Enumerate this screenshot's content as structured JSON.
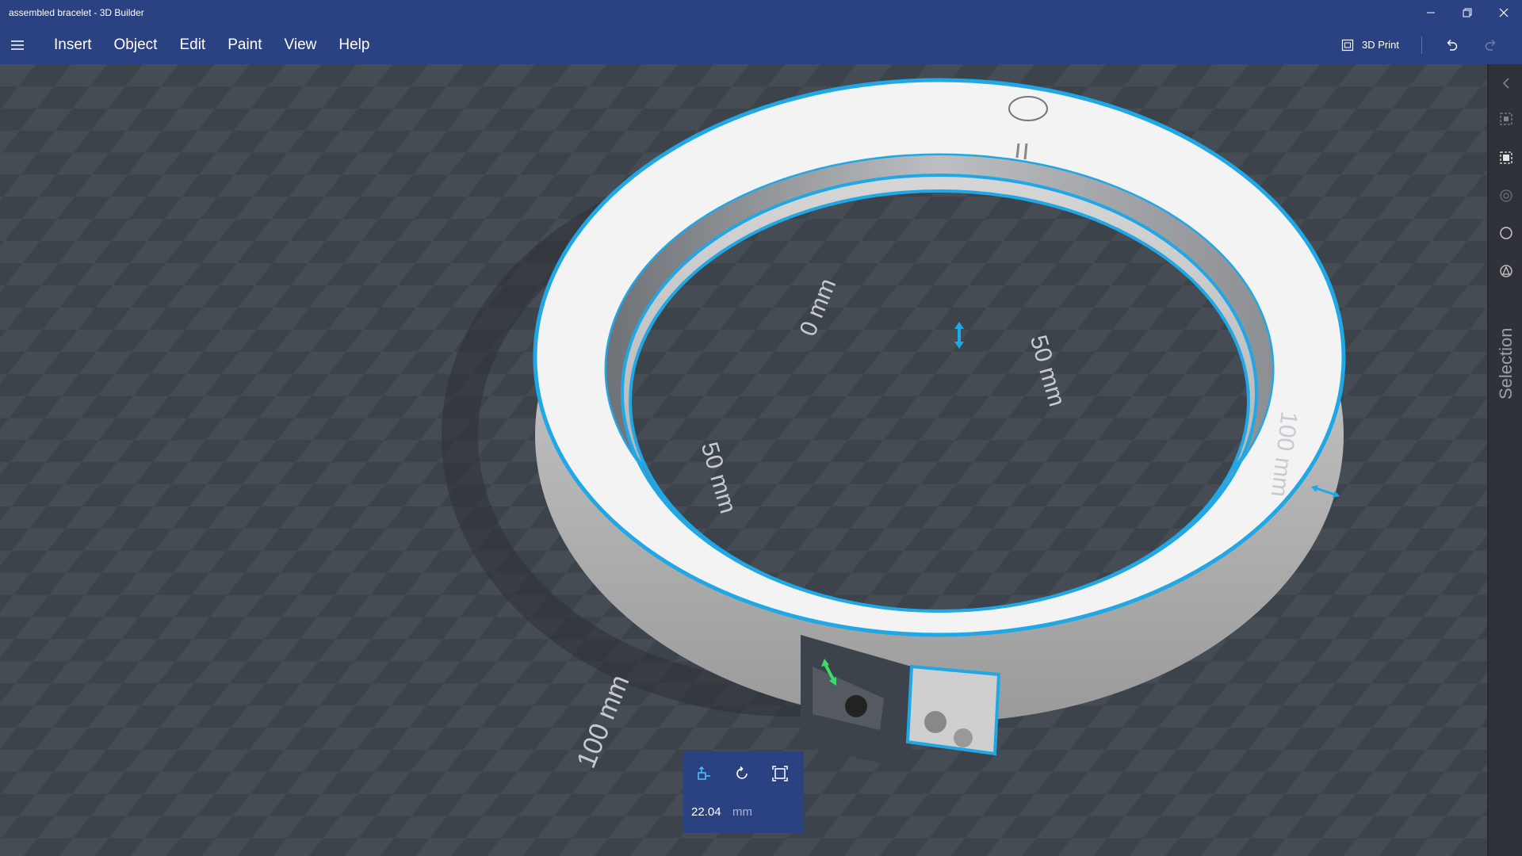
{
  "window": {
    "title": "assembled bracelet - 3D Builder",
    "controls": [
      "minimize-icon",
      "restore-icon",
      "close-icon"
    ]
  },
  "menu": {
    "items": [
      "Insert",
      "Object",
      "Edit",
      "Paint",
      "View",
      "Help"
    ],
    "print_label": "3D Print"
  },
  "viewport": {
    "axis_labels": {
      "a": "0 mm",
      "b": "50 mm",
      "c": "50 mm",
      "d": "100 mm",
      "e": "100 mm"
    },
    "object_name": "assembled bracelet",
    "selection_color": "#1fa7e6",
    "object_color": "#f2f2f2"
  },
  "right_panel": {
    "label": "Selection",
    "icons": [
      "collapse-arrow-icon",
      "select-object-icon",
      "select-faces-icon",
      "select-edges-icon",
      "circle-select-icon",
      "paint-select-icon"
    ]
  },
  "move_panel": {
    "value": "22.04",
    "unit": "mm",
    "tools": [
      "move-icon",
      "rotate-icon",
      "scale-icon"
    ]
  }
}
